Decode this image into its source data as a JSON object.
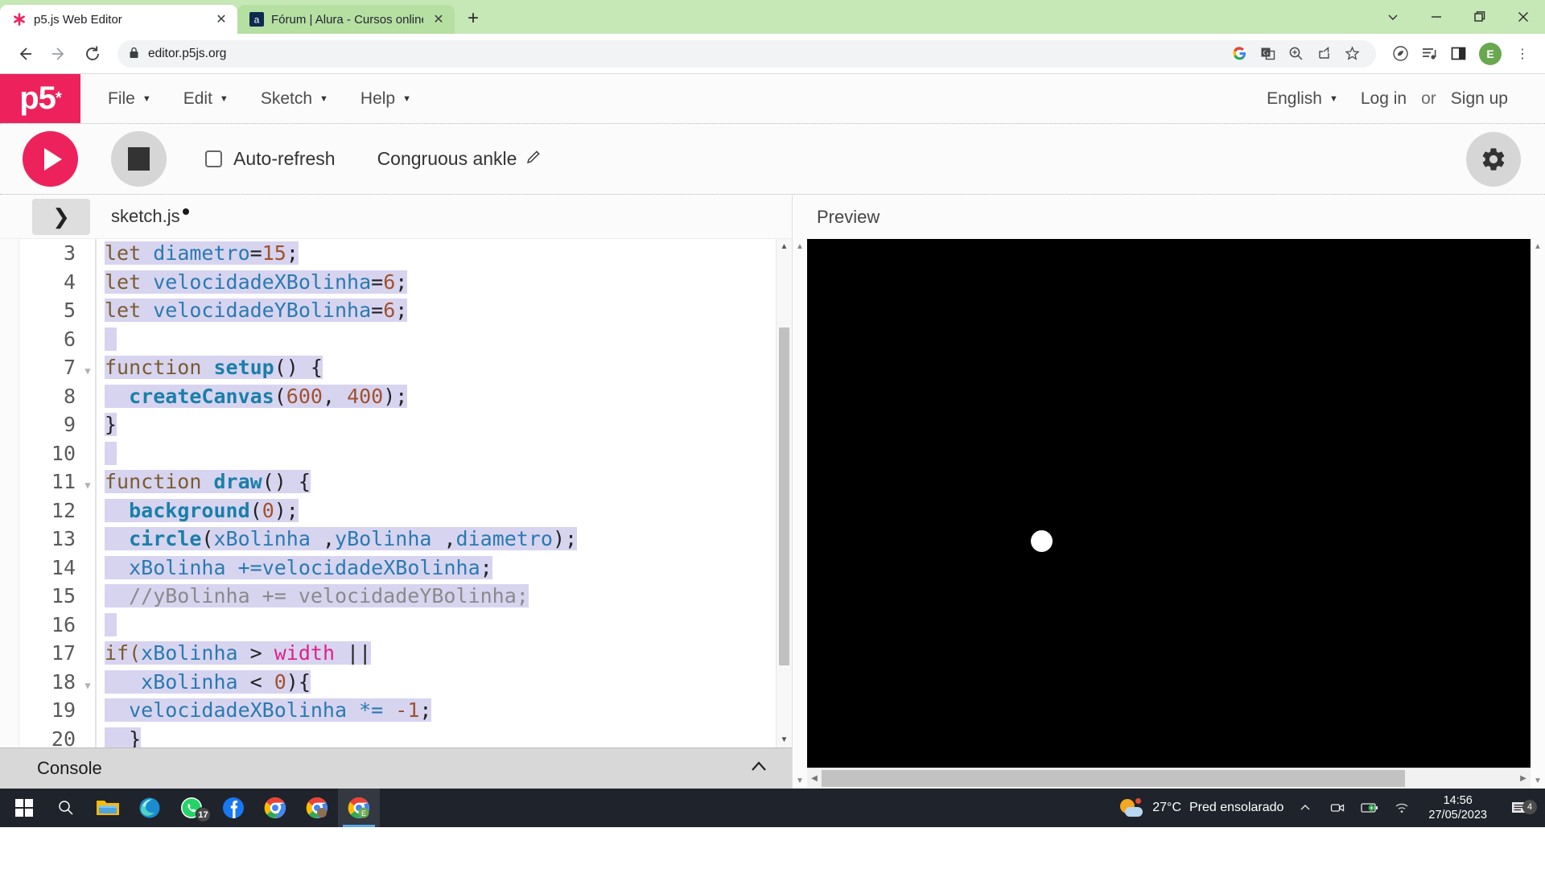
{
  "browser": {
    "tabs": [
      {
        "title": "p5.js Web Editor",
        "favicon": "p5-asterisk-icon",
        "active": true,
        "close_label": "✕"
      },
      {
        "title": "Fórum | Alura - Cursos online de",
        "favicon": "alura-icon",
        "active": false,
        "close_label": "✕"
      }
    ],
    "new_tab_label": "+",
    "window_controls": {
      "minimize_group": "⌄",
      "minimize": "—",
      "maximize": "❐",
      "close": "✕"
    },
    "nav": {
      "back": "←",
      "forward": "→",
      "reload": "⟳"
    },
    "address": {
      "lock": "🔒",
      "url": "editor.p5js.org"
    },
    "toolbar_icons": [
      "google-icon",
      "translate-icon",
      "zoom-icon",
      "share-icon",
      "bookmark-star-icon",
      "leaf-icon",
      "media-list-icon",
      "side-panel-icon"
    ],
    "profile_initial": "E",
    "menu_label": "⋮"
  },
  "p5nav": {
    "logo": "p5",
    "logo_star": "*",
    "menus": [
      {
        "label": "File",
        "caret": "▼"
      },
      {
        "label": "Edit",
        "caret": "▼"
      },
      {
        "label": "Sketch",
        "caret": "▼"
      },
      {
        "label": "Help",
        "caret": "▼"
      }
    ],
    "language": {
      "label": "English",
      "caret": "▼"
    },
    "login": "Log in",
    "or": "or",
    "signup": "Sign up"
  },
  "toolbar": {
    "play_label": "play-button",
    "stop_label": "stop-button",
    "autorefresh_label": "Auto-refresh",
    "autorefresh_checked": false,
    "sketch_name": "Congruous ankle",
    "edit_pencil": "✎",
    "settings_label": "settings-button"
  },
  "editor": {
    "sidebar_toggle": "❯",
    "filename": "sketch.js",
    "unsaved": true,
    "console_label": "Console",
    "console_chevron": "⌃",
    "lines": [
      {
        "num": "3",
        "fold": false,
        "selected": true,
        "tokens": [
          {
            "t": "let ",
            "c": "tok-kw"
          },
          {
            "t": "diametro",
            "c": "tok-var"
          },
          {
            "t": "=",
            "c": "tok-plain"
          },
          {
            "t": "15",
            "c": "tok-num"
          },
          {
            "t": ";",
            "c": "tok-plain"
          }
        ]
      },
      {
        "num": "4",
        "fold": false,
        "selected": true,
        "tokens": [
          {
            "t": "let ",
            "c": "tok-kw"
          },
          {
            "t": "velocidadeXBolinha",
            "c": "tok-var"
          },
          {
            "t": "=",
            "c": "tok-plain"
          },
          {
            "t": "6",
            "c": "tok-num"
          },
          {
            "t": ";",
            "c": "tok-plain"
          }
        ]
      },
      {
        "num": "5",
        "fold": false,
        "selected": true,
        "tokens": [
          {
            "t": "let ",
            "c": "tok-kw"
          },
          {
            "t": "velocidadeYBolinha",
            "c": "tok-var"
          },
          {
            "t": "=",
            "c": "tok-plain"
          },
          {
            "t": "6",
            "c": "tok-num"
          },
          {
            "t": ";",
            "c": "tok-plain"
          }
        ]
      },
      {
        "num": "6",
        "fold": false,
        "selected": true,
        "tokens": [
          {
            "t": " ",
            "c": "tok-plain"
          }
        ]
      },
      {
        "num": "7",
        "fold": true,
        "selected": true,
        "tokens": [
          {
            "t": "function ",
            "c": "tok-kw"
          },
          {
            "t": "setup",
            "c": "tok-def"
          },
          {
            "t": "() {",
            "c": "tok-plain"
          }
        ]
      },
      {
        "num": "8",
        "fold": false,
        "selected": true,
        "tokens": [
          {
            "t": "  ",
            "c": "tok-plain"
          },
          {
            "t": "createCanvas",
            "c": "tok-fn"
          },
          {
            "t": "(",
            "c": "tok-plain"
          },
          {
            "t": "600",
            "c": "tok-num"
          },
          {
            "t": ", ",
            "c": "tok-plain"
          },
          {
            "t": "400",
            "c": "tok-num"
          },
          {
            "t": ");",
            "c": "tok-plain"
          }
        ]
      },
      {
        "num": "9",
        "fold": false,
        "selected": true,
        "tokens": [
          {
            "t": "}",
            "c": "tok-plain"
          }
        ]
      },
      {
        "num": "10",
        "fold": false,
        "selected": true,
        "tokens": [
          {
            "t": " ",
            "c": "tok-plain"
          }
        ]
      },
      {
        "num": "11",
        "fold": true,
        "selected": true,
        "tokens": [
          {
            "t": "function ",
            "c": "tok-kw"
          },
          {
            "t": "draw",
            "c": "tok-def"
          },
          {
            "t": "() {",
            "c": "tok-plain"
          }
        ]
      },
      {
        "num": "12",
        "fold": false,
        "selected": true,
        "tokens": [
          {
            "t": "  ",
            "c": "tok-plain"
          },
          {
            "t": "background",
            "c": "tok-fn"
          },
          {
            "t": "(",
            "c": "tok-plain"
          },
          {
            "t": "0",
            "c": "tok-num"
          },
          {
            "t": ");",
            "c": "tok-plain"
          }
        ]
      },
      {
        "num": "13",
        "fold": false,
        "selected": true,
        "tokens": [
          {
            "t": "  ",
            "c": "tok-plain"
          },
          {
            "t": "circle",
            "c": "tok-fn"
          },
          {
            "t": "(",
            "c": "tok-plain"
          },
          {
            "t": "xBolinha",
            "c": "tok-var"
          },
          {
            "t": " ,",
            "c": "tok-plain"
          },
          {
            "t": "yBolinha",
            "c": "tok-var"
          },
          {
            "t": " ,",
            "c": "tok-plain"
          },
          {
            "t": "diametro",
            "c": "tok-var"
          },
          {
            "t": ");",
            "c": "tok-plain"
          }
        ]
      },
      {
        "num": "14",
        "fold": false,
        "selected": true,
        "tokens": [
          {
            "t": "  ",
            "c": "tok-plain"
          },
          {
            "t": "xBolinha",
            "c": "tok-var"
          },
          {
            "t": " ",
            "c": "tok-plain"
          },
          {
            "t": "+=",
            "c": "tok-op"
          },
          {
            "t": "velocidadeXBolinha",
            "c": "tok-var"
          },
          {
            "t": ";",
            "c": "tok-plain"
          }
        ]
      },
      {
        "num": "15",
        "fold": false,
        "selected": true,
        "tokens": [
          {
            "t": "  //yBolinha += velocidadeYBolinha;",
            "c": "tok-com"
          }
        ]
      },
      {
        "num": "16",
        "fold": false,
        "selected": true,
        "tokens": [
          {
            "t": " ",
            "c": "tok-plain"
          }
        ]
      },
      {
        "num": "17",
        "fold": false,
        "selected": true,
        "tokens": [
          {
            "t": "if(",
            "c": "tok-kw"
          },
          {
            "t": "xBolinha",
            "c": "tok-var"
          },
          {
            "t": " > ",
            "c": "tok-plain"
          },
          {
            "t": "width",
            "c": "tok-builtin"
          },
          {
            "t": " ||",
            "c": "tok-plain"
          }
        ]
      },
      {
        "num": "18",
        "fold": true,
        "selected": true,
        "tokens": [
          {
            "t": "   ",
            "c": "tok-plain"
          },
          {
            "t": "xBolinha",
            "c": "tok-var"
          },
          {
            "t": " < ",
            "c": "tok-plain"
          },
          {
            "t": "0",
            "c": "tok-num"
          },
          {
            "t": "){",
            "c": "tok-plain"
          }
        ]
      },
      {
        "num": "19",
        "fold": false,
        "selected": true,
        "tokens": [
          {
            "t": "  ",
            "c": "tok-plain"
          },
          {
            "t": "velocidadeXBolinha",
            "c": "tok-var"
          },
          {
            "t": " ",
            "c": "tok-plain"
          },
          {
            "t": "*=",
            "c": "tok-op"
          },
          {
            "t": " ",
            "c": "tok-plain"
          },
          {
            "t": "-1",
            "c": "tok-num"
          },
          {
            "t": ";",
            "c": "tok-plain"
          }
        ]
      },
      {
        "num": "20",
        "fold": false,
        "selected": true,
        "tokens": [
          {
            "t": "  }",
            "c": "tok-plain"
          }
        ]
      }
    ]
  },
  "preview": {
    "label": "Preview",
    "canvas_bg": "#000000",
    "ball_color": "#ffffff",
    "ball_diameter": 15,
    "scroll_up": "▲",
    "scroll_down": "▼",
    "scroll_left": "◀",
    "scroll_right": "▶"
  },
  "taskbar": {
    "start": "windows-logo",
    "search": "search-icon",
    "apps": [
      {
        "name": "file-explorer-icon",
        "badge": null
      },
      {
        "name": "microsoft-edge-icon",
        "badge": null
      },
      {
        "name": "whatsapp-icon",
        "badge": "17"
      },
      {
        "name": "facebook-icon",
        "badge": null
      },
      {
        "name": "google-chrome-icon",
        "badge": null
      },
      {
        "name": "chrome-profile-icon",
        "badge": null
      },
      {
        "name": "chrome-active-icon",
        "badge": null
      }
    ],
    "weather_temp": "27°C",
    "weather_desc": "Pred ensolarado",
    "tray_chevron": "⌃",
    "tray_icons": [
      "camera-icon",
      "battery-icon",
      "wifi-icon"
    ],
    "time": "14:56",
    "date": "27/05/2023",
    "notification_count": "4"
  },
  "colors": {
    "p5_pink": "#ed225d",
    "tab_strip": "#c6e7b6",
    "selection": "#d7d4f0",
    "taskbar": "#1f232b"
  }
}
